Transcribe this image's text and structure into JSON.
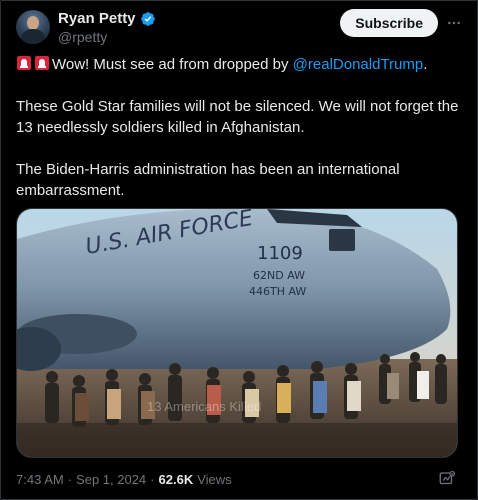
{
  "author": {
    "display_name": "Ryan Petty",
    "handle": "@rpetty",
    "verified": true
  },
  "header": {
    "subscribe_label": "Subscribe"
  },
  "tweet": {
    "line1_text": "Wow! Must see ad from dropped by ",
    "line1_mention": "@realDonaldTrump",
    "line1_end": ".",
    "paragraph2": "These Gold Star families will not be silenced.  We will not forget the 13 needlessly soldiers killed in Afghanistan.",
    "paragraph3": "The Biden-Harris administration has been an international embarrassment."
  },
  "media": {
    "aircraft_text_1": "U.S. AIR FORCE",
    "aircraft_text_2": "1109",
    "aircraft_text_3": "62ND AW",
    "aircraft_text_4": "446TH AW",
    "watermark": "13 Americans Killed"
  },
  "meta": {
    "time": "7:43 AM",
    "separator1": "·",
    "date": "Sep 1, 2024",
    "separator2": "·",
    "views_count": "62.6K",
    "views_label": "Views"
  },
  "colors": {
    "background": "#000000",
    "text_primary": "#e7e9ea",
    "text_secondary": "#71767b",
    "link": "#1d9bf0",
    "verified": "#1d9bf0",
    "border": "#2f3336"
  },
  "icons": {
    "verified": "verified-badge-icon",
    "more": "more-horizontal-icon",
    "siren": "police-light-emoji",
    "grok": "grok-icon"
  }
}
